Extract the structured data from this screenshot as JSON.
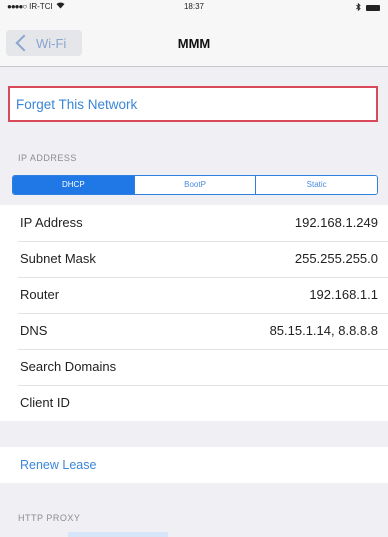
{
  "status_bar": {
    "signal": "●●●●○",
    "carrier": "IR-TCI",
    "wifi": "wifi-icon",
    "time": "18:37",
    "bluetooth": "bluetooth-icon",
    "battery": "battery-icon"
  },
  "nav": {
    "back_label": "Wi-Fi",
    "title": "MMM"
  },
  "forget_label": "Forget This Network",
  "ip_address_section": {
    "header": "IP ADDRESS",
    "segments": [
      {
        "label": "DHCP",
        "selected": true
      },
      {
        "label": "BootP",
        "selected": false
      },
      {
        "label": "Static",
        "selected": false
      }
    ],
    "rows": [
      {
        "label": "IP Address",
        "value": "192.168.1.249"
      },
      {
        "label": "Subnet Mask",
        "value": "255.255.255.0"
      },
      {
        "label": "Router",
        "value": "192.168.1.1"
      },
      {
        "label": "DNS",
        "value": "85.15.1.14, 8.8.8.8"
      },
      {
        "label": "Search Domains",
        "value": ""
      },
      {
        "label": "Client ID",
        "value": ""
      }
    ]
  },
  "renew_lease_label": "Renew Lease",
  "http_proxy_header": "HTTP PROXY",
  "colors": {
    "accent": "#1f78e6",
    "link": "#3a86d9",
    "highlight_border": "#d9495a"
  }
}
